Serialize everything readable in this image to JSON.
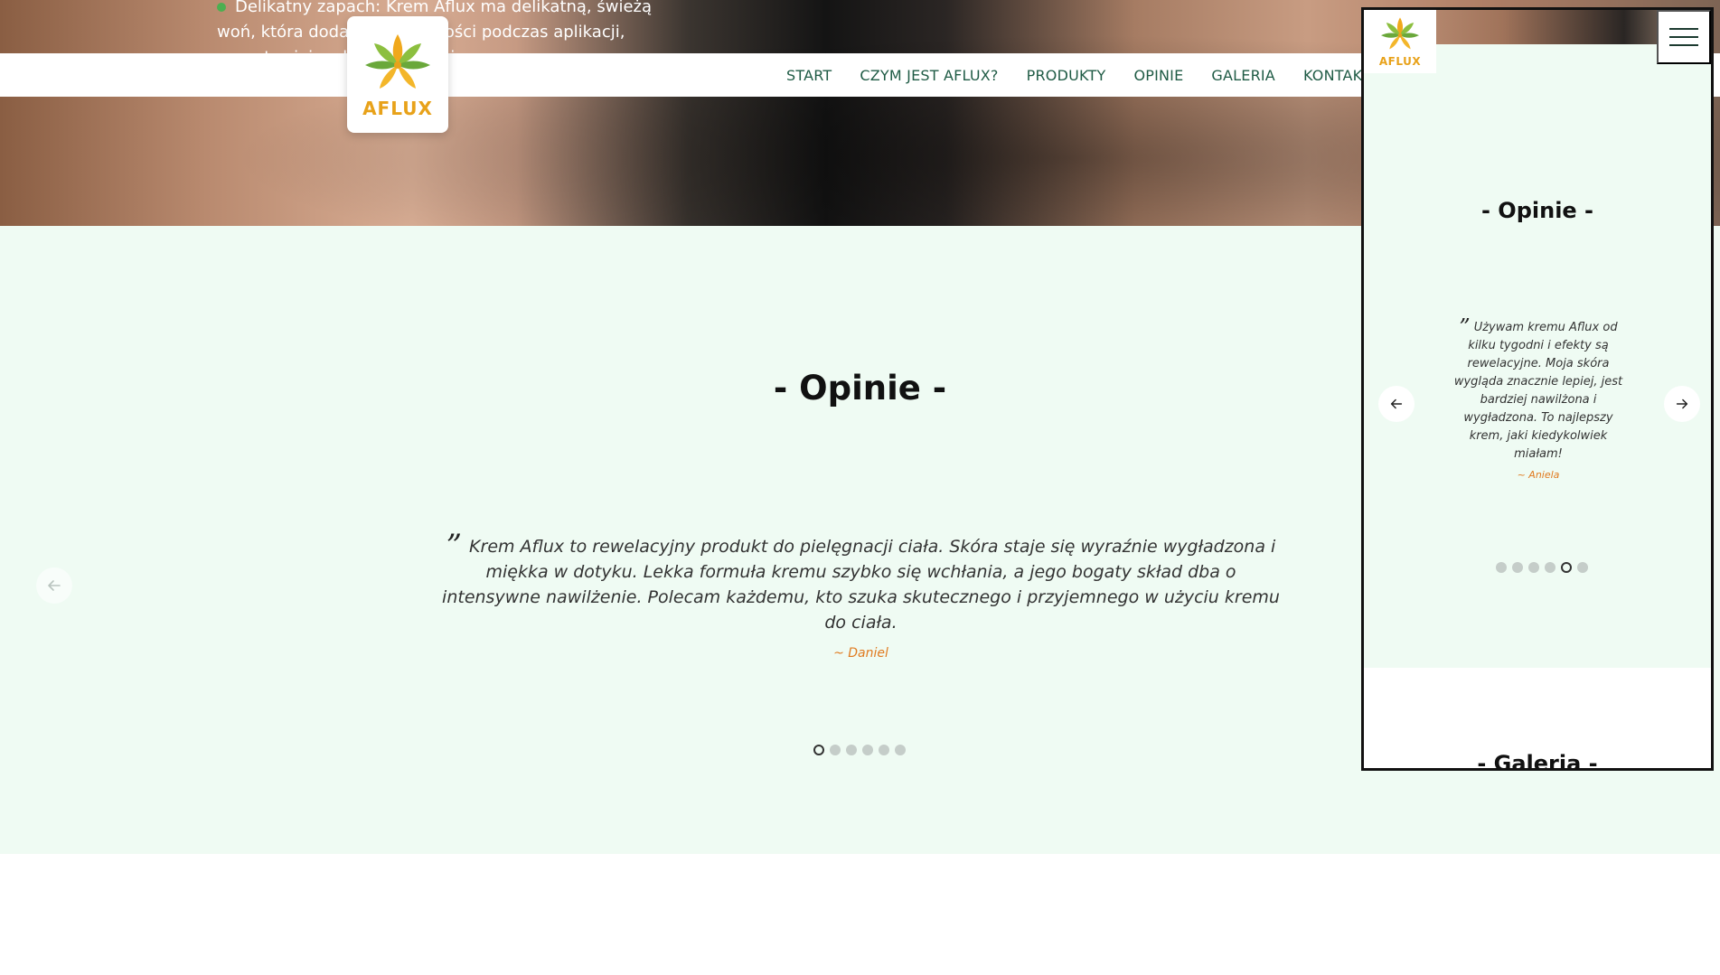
{
  "hero": {
    "text": "Delikatny zapach: Krem Aflux ma delikatną, świeżą woń, która dodaje przyjemności podczas aplikacji, pozostawiając dłonie odświeżone"
  },
  "brand": {
    "logo_text": "AFLUX",
    "color": "#e8a21a"
  },
  "nav": {
    "items": [
      {
        "label": "START"
      },
      {
        "label": "CZYM JEST AFLUX?"
      },
      {
        "label": "PRODUKTY"
      },
      {
        "label": "OPINIE"
      },
      {
        "label": "GALERIA"
      },
      {
        "label": "KONTAKT"
      }
    ]
  },
  "reviews": {
    "title": "- Opinie -",
    "quote": "Krem Aflux to rewelacyjny produkt do pielęgnacji ciała. Skóra staje się wyraźnie wygładzona i miękka w dotyku. Lekka formuła kremu szybko się wchłania, a jego bogaty skład dba o intensywne nawilżenie. Polecam każdemu, kto szuka skutecznego i przyjemnego w użyciu kremu do ciała.",
    "author": "~ Daniel",
    "slide_count": 6,
    "active_slide": 1
  },
  "mobile": {
    "reviews_title": "- Opinie -",
    "quote": "Używam kremu Aflux od kilku tygodni i efekty są rewelacyjne. Moja skóra wygląda znacznie lepiej, jest bardziej nawilżona i wygładzona. To najlepszy krem, jaki kiedykolwiek miałam!",
    "author": "~ Aniela",
    "active_slide": 5,
    "gallery_title": "- Galeria -"
  },
  "colors": {
    "section_bg": "#effbf3",
    "nav_text": "#1f5b45",
    "author": "#e07a1f"
  },
  "icons": {
    "prev": "arrow-left-icon",
    "next": "arrow-right-icon",
    "menu": "hamburger-icon",
    "quote": "quote-icon",
    "logo": "lotus-icon"
  }
}
